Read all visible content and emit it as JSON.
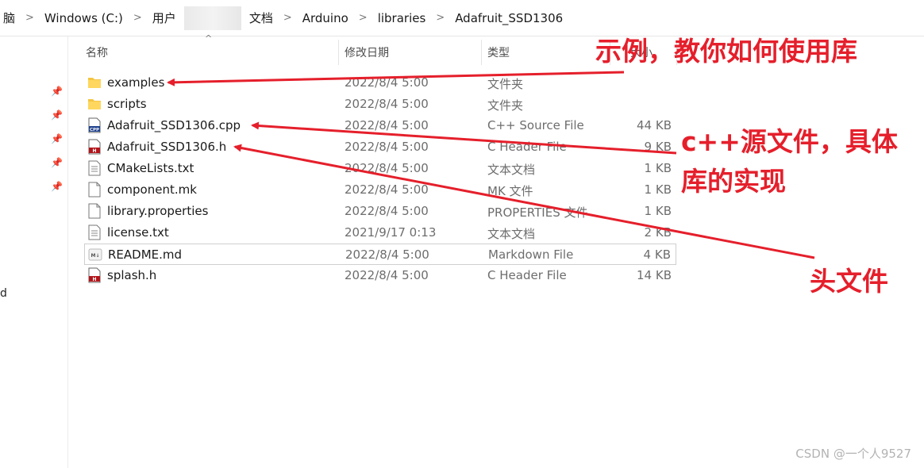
{
  "breadcrumb": {
    "items": [
      "脑",
      "Windows (C:)",
      "用户",
      "文档",
      "Arduino",
      "libraries",
      "Adafruit_SSD1306"
    ]
  },
  "columns": {
    "name": "名称",
    "date": "修改日期",
    "type": "类型",
    "size": "大小"
  },
  "nav": {
    "fragment": "d"
  },
  "files": [
    {
      "name": "examples",
      "date": "2022/8/4 5:00",
      "type": "文件夹",
      "size": "",
      "icon": "folder-icon"
    },
    {
      "name": "scripts",
      "date": "2022/8/4 5:00",
      "type": "文件夹",
      "size": "",
      "icon": "folder-icon"
    },
    {
      "name": "Adafruit_SSD1306.cpp",
      "date": "2022/8/4 5:00",
      "type": "C++ Source File",
      "size": "44 KB",
      "icon": "cpp-file-icon"
    },
    {
      "name": "Adafruit_SSD1306.h",
      "date": "2022/8/4 5:00",
      "type": "C Header File",
      "size": "9 KB",
      "icon": "h-file-icon"
    },
    {
      "name": "CMakeLists.txt",
      "date": "2022/8/4 5:00",
      "type": "文本文档",
      "size": "1 KB",
      "icon": "text-file-icon"
    },
    {
      "name": "component.mk",
      "date": "2022/8/4 5:00",
      "type": "MK 文件",
      "size": "1 KB",
      "icon": "blank-file-icon"
    },
    {
      "name": "library.properties",
      "date": "2022/8/4 5:00",
      "type": "PROPERTIES 文件",
      "size": "1 KB",
      "icon": "blank-file-icon"
    },
    {
      "name": "license.txt",
      "date": "2021/9/17 0:13",
      "type": "文本文档",
      "size": "2 KB",
      "icon": "text-file-icon"
    },
    {
      "name": "README.md",
      "date": "2022/8/4 5:00",
      "type": "Markdown File",
      "size": "4 KB",
      "icon": "markdown-file-icon"
    },
    {
      "name": "splash.h",
      "date": "2022/8/4 5:00",
      "type": "C Header File",
      "size": "14 KB",
      "icon": "h-file-icon"
    }
  ],
  "annotations": {
    "examples": "示例，教你如何使用库",
    "cpp_line1": "c++源文件，具体",
    "cpp_line2": "库的实现",
    "header": "头文件",
    "color": "#e51f2b"
  },
  "watermark": "CSDN @一个人9527"
}
